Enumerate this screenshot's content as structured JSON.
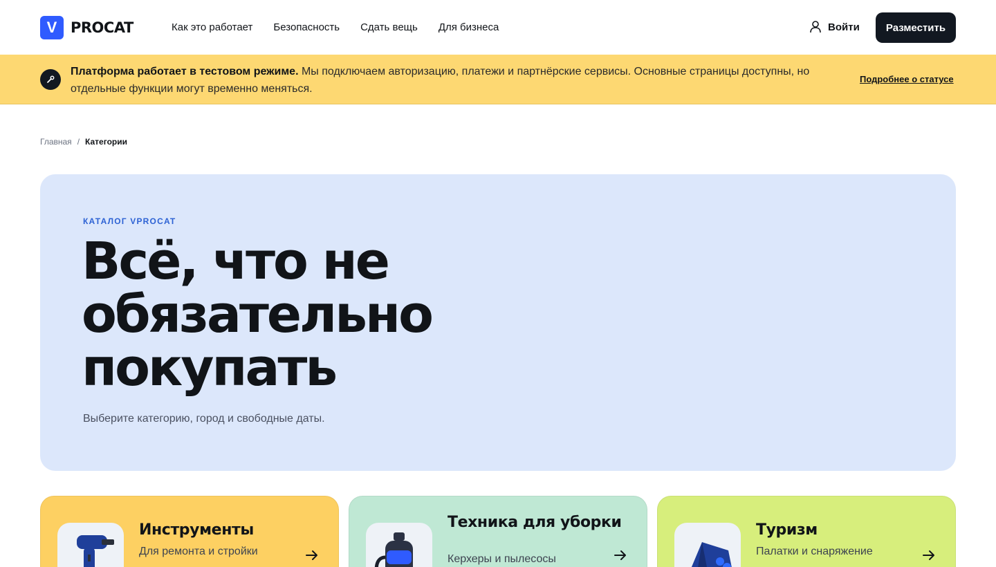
{
  "header": {
    "logo_mark": "V",
    "logo_text": "PROCAT",
    "nav": [
      "Как это работает",
      "Безопасность",
      "Сдать вещь",
      "Для бизнеса"
    ],
    "login_label": "Войти",
    "post_label": "Разместить"
  },
  "banner": {
    "bold": "Платформа работает в тестовом режиме.",
    "text": " Мы подключаем авторизацию, платежи и партнёрские сервисы. Основные страницы доступны, но отдельные функции могут временно меняться.",
    "link": "Подробнее о статусе"
  },
  "breadcrumb": {
    "home": "Главная",
    "separator": "/",
    "current": "Категории"
  },
  "hero": {
    "eyebrow": "КАТАЛОГ VPROCAT",
    "title_line1": "Всё, что не",
    "title_line2": "обязательно",
    "title_line3": "покупать",
    "subtitle": "Выберите категорию, город и свободные даты."
  },
  "categories": [
    {
      "title": "Инструменты",
      "subtitle": "Для ремонта и стройки",
      "color": "#fdd062",
      "icon": "drill-icon"
    },
    {
      "title": "Техника для уборки",
      "subtitle": "Керхеры и пылесосы",
      "color": "#bfe8d4",
      "icon": "vacuum-icon"
    },
    {
      "title": "Туризм",
      "subtitle": "Палатки и снаряжение",
      "color": "#d7ee7c",
      "icon": "tent-icon"
    }
  ],
  "colors": {
    "brand": "#2f5bff",
    "banner": "#fdd872",
    "hero_bg": "#dce7fb",
    "dark": "#121821"
  }
}
